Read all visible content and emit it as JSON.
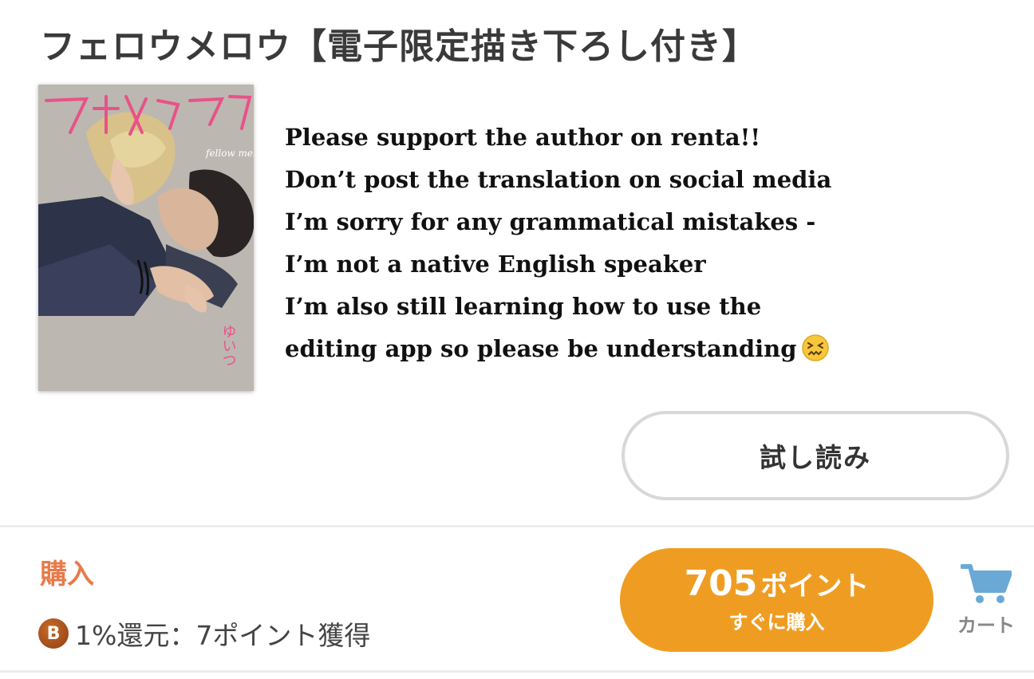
{
  "book": {
    "title": "フェロウメロウ【電子限定描き下ろし付き】",
    "cover": {
      "title_text": "フェロウメロウ",
      "subtitle_text": "fellow mellow",
      "author_text": "ゆいつ"
    }
  },
  "note": {
    "lines": [
      "Please support the author on renta!!",
      "Don’t post the translation on social media",
      "I’m sorry for any grammatical mistakes -",
      "I’m not a native English speaker",
      "I’m also still learning how to use the",
      "editing app so please be understanding"
    ],
    "emoji": "😖"
  },
  "actions": {
    "trial_label": "試し読み",
    "purchase_label": "購入",
    "points_badge": "B",
    "points_text": "1%還元：7ポイント獲得",
    "buy_price": "705",
    "buy_unit": "ポイント",
    "buy_sub": "すぐに購入",
    "cart_label": "カート"
  },
  "colors": {
    "accent_orange": "#ef9d22",
    "purchase_label": "#e87a4a",
    "cart_icon": "#6aa9d6"
  }
}
